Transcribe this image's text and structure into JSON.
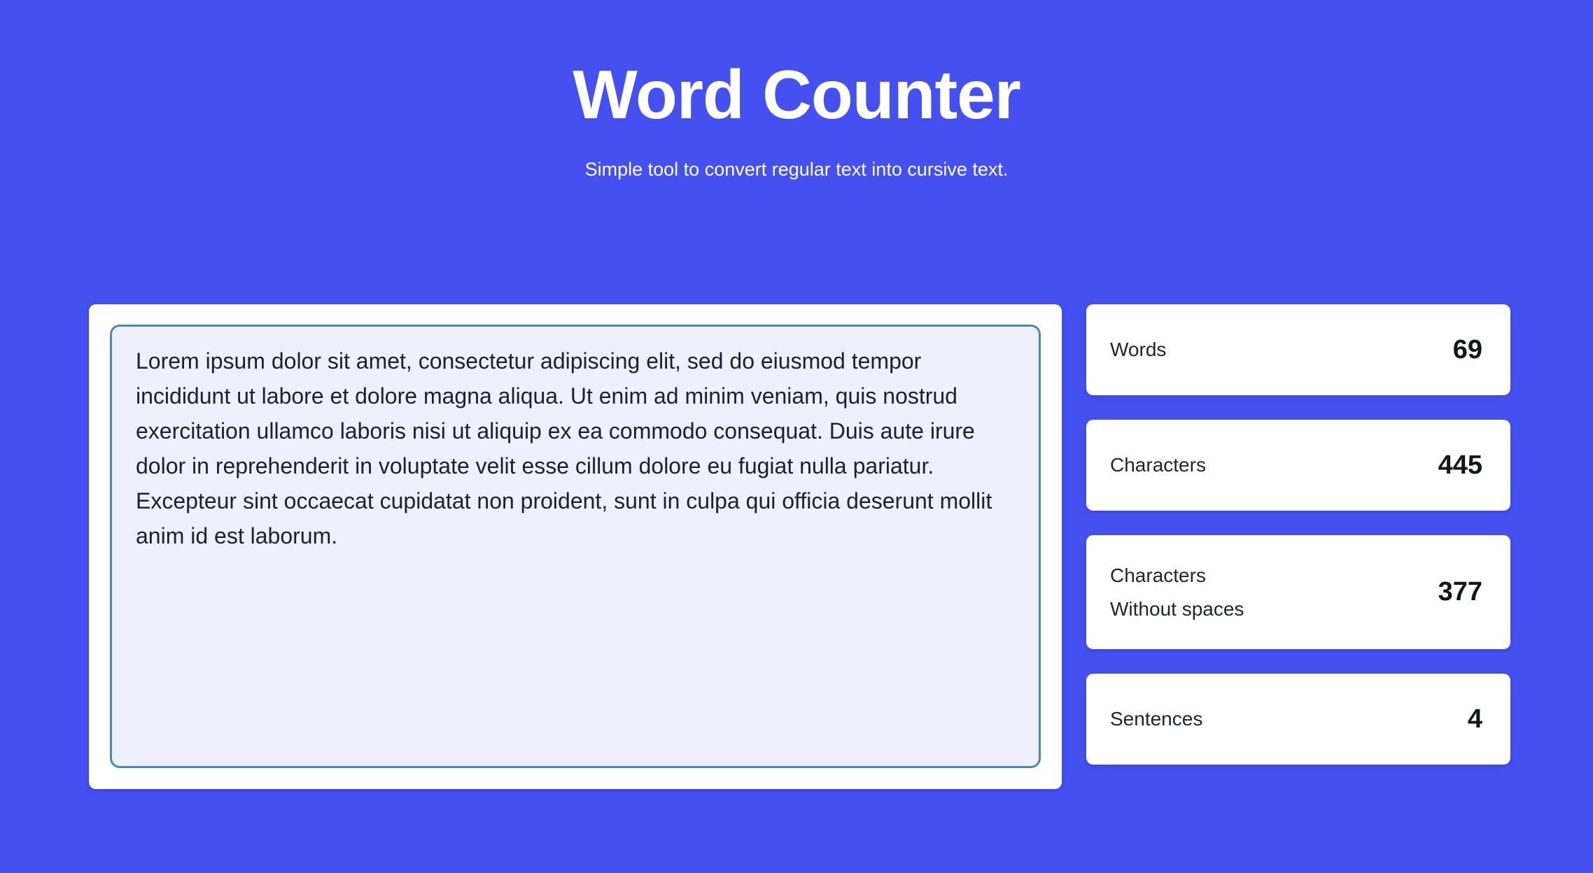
{
  "header": {
    "title": "Word Counter",
    "subtitle": "Simple tool to convert regular text into cursive text."
  },
  "editor": {
    "name": "text-input",
    "placeholder": "Enter your text here...",
    "value": "Lorem ipsum dolor sit amet, consectetur adipiscing elit, sed do eiusmod tempor incididunt ut labore et dolore magna aliqua. Ut enim ad minim veniam, quis nostrud exercitation ullamco laboris nisi ut aliquip ex ea commodo consequat. Duis aute irure dolor in reprehenderit in voluptate velit esse cillum dolore eu fugiat nulla pariatur. Excepteur sint occaecat cupidatat non proident, sunt in culpa qui officia deserunt mollit anim id est laborum.",
    "focused": true
  },
  "stats": [
    {
      "label": "Words",
      "value": "69"
    },
    {
      "label": "Characters",
      "value": "445"
    },
    {
      "label": "Characters\nWithout spaces",
      "value": "377"
    },
    {
      "label": "Sentences",
      "value": "4"
    }
  ],
  "colors": {
    "background": "#4550f0",
    "card": "#ffffff",
    "textarea_background": "#eef0fc",
    "textarea_border": "#4a85c4",
    "text_dark": "#1c2030",
    "text_light": "#ffffff"
  }
}
